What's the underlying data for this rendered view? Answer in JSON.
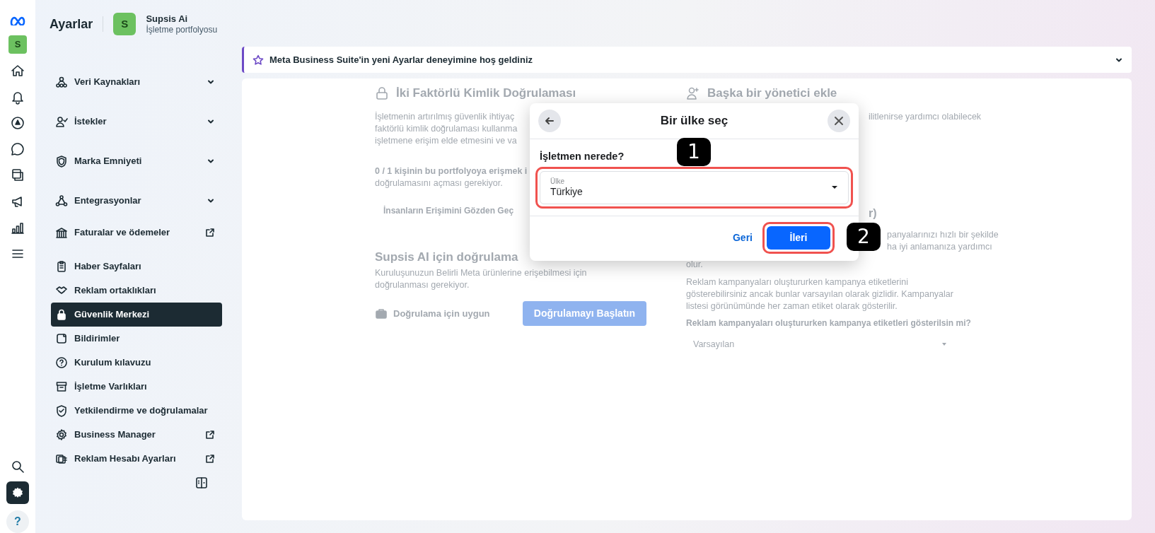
{
  "header": {
    "title": "Ayarlar",
    "business": {
      "avatar": "S",
      "name": "Supsis Ai",
      "subtitle": "İşletme portfolyosu"
    }
  },
  "rail": {
    "avatar": "S",
    "items": [
      {
        "selected": false
      },
      {
        "selected": false
      },
      {
        "selected": false
      },
      {
        "selected": false
      },
      {
        "selected": false
      },
      {
        "selected": false
      },
      {
        "selected": false
      },
      {
        "selected": false
      }
    ],
    "bottom": [
      {
        "kind": "search",
        "selected": false
      },
      {
        "kind": "settings",
        "selected": true
      },
      {
        "kind": "help",
        "selected": false,
        "label": "?"
      }
    ]
  },
  "sidebar": {
    "items": [
      {
        "kind": "group",
        "label": "Veri Kaynakları",
        "selected": false
      },
      {
        "kind": "group",
        "label": "İstekler",
        "selected": false
      },
      {
        "kind": "group",
        "label": "Marka Emniyeti",
        "selected": false
      },
      {
        "kind": "group",
        "label": "Entegrasyonlar",
        "selected": false
      },
      {
        "kind": "external",
        "label": "Faturalar ve ödemeler",
        "selected": false
      },
      {
        "kind": "item",
        "label": "Haber Sayfaları",
        "selected": false
      },
      {
        "kind": "item",
        "label": "Reklam ortaklıkları",
        "selected": false
      },
      {
        "kind": "item",
        "label": "Güvenlik Merkezi",
        "selected": true
      },
      {
        "kind": "item",
        "label": "Bildirimler",
        "selected": false
      },
      {
        "kind": "item",
        "label": "Kurulum kılavuzu",
        "selected": false
      },
      {
        "kind": "item",
        "label": "İşletme Varlıkları",
        "selected": false
      },
      {
        "kind": "item",
        "label": "Yetkilendirme ve doğrulamalar",
        "selected": false
      },
      {
        "kind": "external",
        "label": "Business Manager",
        "selected": false
      },
      {
        "kind": "external",
        "label": "Reklam Hesabı Ayarları",
        "selected": false
      }
    ]
  },
  "banner": {
    "text": "Meta Business Suite'in yeni Ayarlar deneyimine hoş geldiniz",
    "expanded": false
  },
  "background": {
    "left": {
      "title": "İki Faktörlü Kimlik Doğrulaması",
      "lines": [
        "İşletmenin artırılmış güvenlik ihtiyaç",
        "faktörlü kimlik doğrulaması kullanma",
        "işletmene erişim elde etmesini ve va"
      ],
      "count_lines": [
        "0 / 1 kişinin bu portfolyoya erişmek i",
        "doğrulamasını açması gerekiyor."
      ],
      "link": "İnsanların Erişimini Gözden Geç",
      "section_title": "Supsis AI için doğrulama",
      "section_text": "Kuruluşunuzun Belirli Meta ürünlerine erişebilmesi için doğrulanması gerekiyor.",
      "status": "Doğrulama için uygun",
      "button": "Doğrulamayı Başlatın"
    },
    "right": {
      "title": "Başka bir yönetici ekle",
      "fragments": [
        "ilitlenirse yardımcı olabilecek",
        "r)",
        "panyalarınızı hızlı bir şekilde",
        "ha iyi anlamanıza yardımcı"
      ],
      "tail": "olur.",
      "text": "Reklam kampanyaları oluştururken kampanya etiketlerini gösterebilirsiniz ancak bunlar varsayılan olarak gizlidir. Kampanyalar listesi görünümünde her zaman etiket olarak gösterilir.",
      "question": "Reklam kampanyaları oluştururken kampanya etiketleri gösterilsin mi?",
      "select": "Varsayılan"
    }
  },
  "dialog": {
    "title": "Bir ülke seç",
    "question": "İşletmen nerede?",
    "field": {
      "label": "Ülke",
      "value": "Türkiye"
    },
    "back": "Geri",
    "next": "İleri"
  },
  "annotations": [
    {
      "label": "1"
    },
    {
      "label": "2"
    }
  ]
}
